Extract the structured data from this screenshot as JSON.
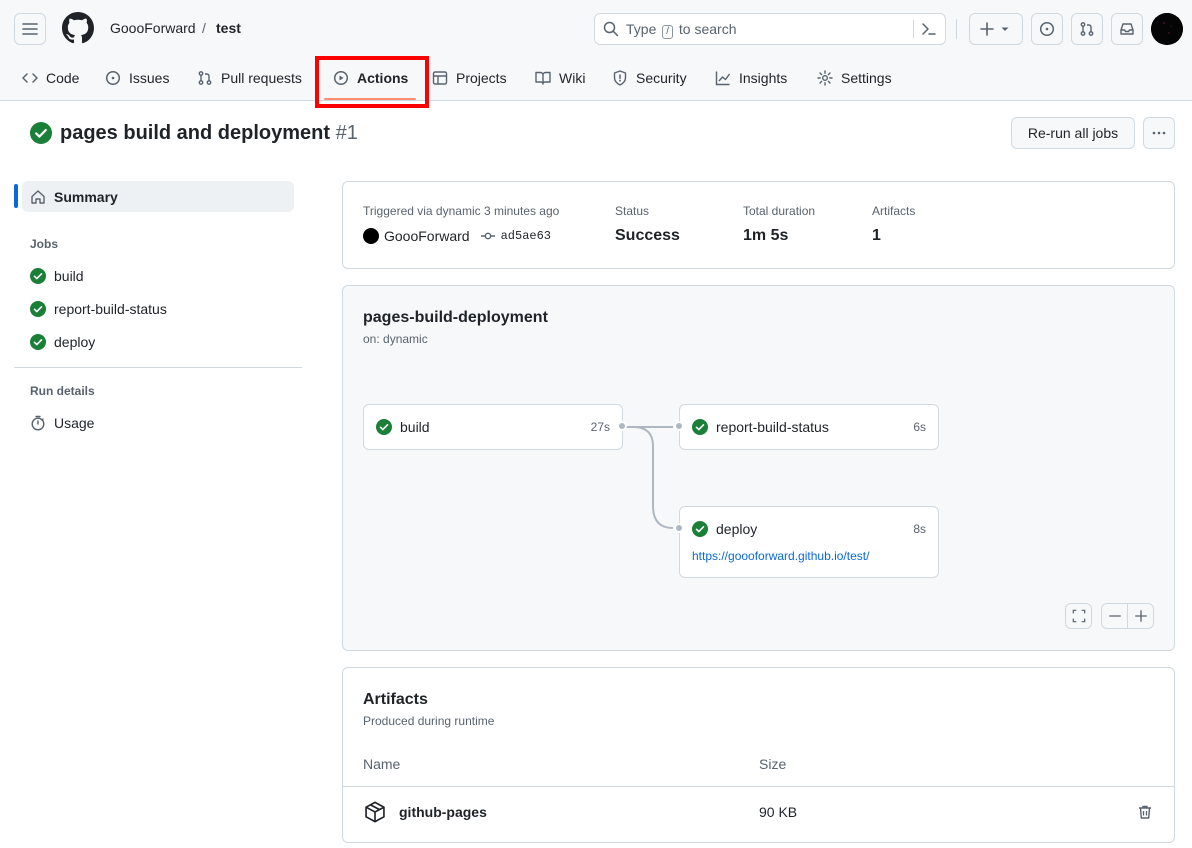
{
  "header": {
    "owner": "GoooForward",
    "separator": "/",
    "repo": "test",
    "search_prefix": "Type",
    "search_key": "/",
    "search_suffix": "to search"
  },
  "tabs": [
    {
      "label": "Code",
      "icon": "code-icon"
    },
    {
      "label": "Issues",
      "icon": "issue-opened-icon"
    },
    {
      "label": "Pull requests",
      "icon": "git-pull-request-icon"
    },
    {
      "label": "Actions",
      "icon": "play-icon",
      "active": true
    },
    {
      "label": "Projects",
      "icon": "table-icon"
    },
    {
      "label": "Wiki",
      "icon": "book-icon"
    },
    {
      "label": "Security",
      "icon": "shield-icon"
    },
    {
      "label": "Insights",
      "icon": "graph-icon"
    },
    {
      "label": "Settings",
      "icon": "gear-icon"
    }
  ],
  "run": {
    "title": "pages build and deployment",
    "number": "#1",
    "rerun_label": "Re-run all jobs"
  },
  "sidebar": {
    "summary": "Summary",
    "jobs_heading": "Jobs",
    "jobs": [
      "build",
      "report-build-status",
      "deploy"
    ],
    "run_details_heading": "Run details",
    "usage": "Usage"
  },
  "meta": {
    "trigger_text": "Triggered via dynamic 3 minutes ago",
    "actor": "GoooForward",
    "commit": "ad5ae63",
    "status_label": "Status",
    "status_value": "Success",
    "duration_label": "Total duration",
    "duration_value": "1m 5s",
    "artifacts_label": "Artifacts",
    "artifacts_value": "1"
  },
  "workflow": {
    "name": "pages-build-deployment",
    "trigger": "on: dynamic",
    "jobs": {
      "build": {
        "name": "build",
        "time": "27s"
      },
      "report": {
        "name": "report-build-status",
        "time": "6s"
      },
      "deploy": {
        "name": "deploy",
        "time": "8s",
        "url": "https://goooforward.github.io/test/"
      }
    }
  },
  "artifacts": {
    "title": "Artifacts",
    "subtitle": "Produced during runtime",
    "col_name": "Name",
    "col_size": "Size",
    "rows": [
      {
        "name": "github-pages",
        "size": "90 KB"
      }
    ]
  },
  "colors": {
    "success": "#1a7f37",
    "link": "#0969da",
    "accent_underline": "#fd8c73",
    "highlight": "#ff0000"
  }
}
